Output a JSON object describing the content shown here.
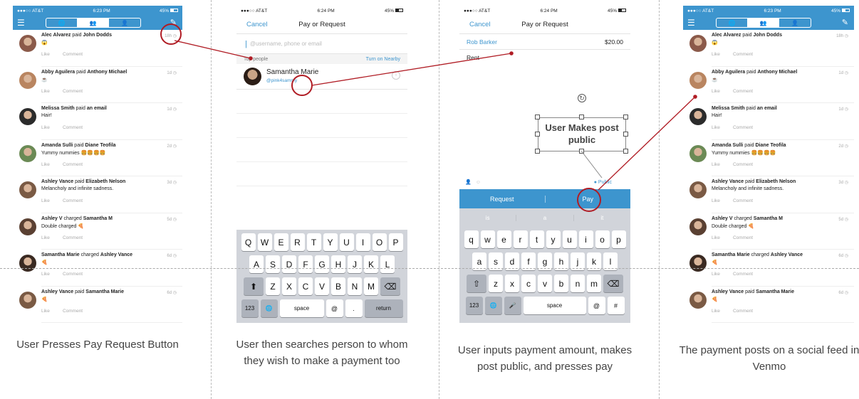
{
  "status": {
    "carrier": "●●●○○ AT&T",
    "time1": "6:23 PM",
    "time2": "6:24 PM",
    "battery": "45%"
  },
  "feed": [
    {
      "user": "Alec Alvarez",
      "verb": "paid",
      "target": "John Dodds",
      "time": "18h",
      "msg": "😱",
      "avatar": "#8b5a4a"
    },
    {
      "user": "Abby Aguilera",
      "verb": "paid",
      "target": "Anthony Michael",
      "time": "1d",
      "msg": "☕",
      "avatar": "#b98560"
    },
    {
      "user": "Melissa Smith",
      "verb": "paid",
      "target": "an email",
      "time": "1d",
      "msg": "Hair!",
      "avatar": "#2b2b2b"
    },
    {
      "user": "Amanda Sulli",
      "verb": "paid",
      "target": "Diane Teofila",
      "time": "2d",
      "msg": "Yummy nummies 🍔🍔🍔🍔",
      "avatar": "#6b8a55"
    },
    {
      "user": "Ashley Vance",
      "verb": "paid",
      "target": "Elizabeth Nelson",
      "time": "3d",
      "msg": "Melancholy and infinite sadness.",
      "avatar": "#7a5a44"
    },
    {
      "user": "Ashley V",
      "verb": "charged",
      "target": "Samantha M",
      "time": "5d",
      "msg": "Double charged 🍕",
      "avatar": "#5a4032"
    },
    {
      "user": "Samantha Marie",
      "verb": "charged",
      "target": "Ashley Vance",
      "time": "6d",
      "msg": "🍕",
      "avatar": "#3a2a22"
    },
    {
      "user": "Ashley Vance",
      "verb": "paid",
      "target": "Samantha Marie",
      "time": "6d",
      "msg": "🍕",
      "avatar": "#7a5a44"
    }
  ],
  "feed_actions": {
    "like": "Like",
    "comment": "Comment"
  },
  "pay_request": {
    "title": "Pay or Request",
    "cancel": "Cancel",
    "to_placeholder": "@username, phone or email",
    "top_people": "Top people",
    "nearby": "Turn on Nearby",
    "person_name": "Samantha Marie",
    "person_handle": "@pink4sammy"
  },
  "payment": {
    "recipient": "Rob Barker",
    "amount": "$20.00",
    "note": "Rent",
    "audience": "Public",
    "request_label": "Request",
    "pay_label": "Pay",
    "suggestions": [
      "is",
      "a",
      "it"
    ],
    "callout": "User Makes post public"
  },
  "keyboard_upper": [
    [
      "Q",
      "W",
      "E",
      "R",
      "T",
      "Y",
      "U",
      "I",
      "O",
      "P"
    ],
    [
      "A",
      "S",
      "D",
      "F",
      "G",
      "H",
      "J",
      "K",
      "L"
    ],
    [
      "Z",
      "X",
      "C",
      "V",
      "B",
      "N",
      "M"
    ]
  ],
  "keyboard_lower": [
    [
      "q",
      "w",
      "e",
      "r",
      "t",
      "y",
      "u",
      "i",
      "o",
      "p"
    ],
    [
      "a",
      "s",
      "d",
      "f",
      "g",
      "h",
      "j",
      "k",
      "l"
    ],
    [
      "z",
      "x",
      "c",
      "v",
      "b",
      "n",
      "m"
    ]
  ],
  "keys": {
    "num": "123",
    "space": "space",
    "at": "@",
    "dot": ".",
    "return": "return",
    "hash": "#"
  },
  "captions": [
    "User Presses Pay Request Button",
    "User then searches person to whom they wish to make a payment too",
    "User inputs payment amount, makes post public, and presses pay",
    "The payment posts on a social feed in Venmo"
  ],
  "colors": {
    "venmo_blue": "#3d95ce",
    "highlight_red": "#b01c24"
  }
}
